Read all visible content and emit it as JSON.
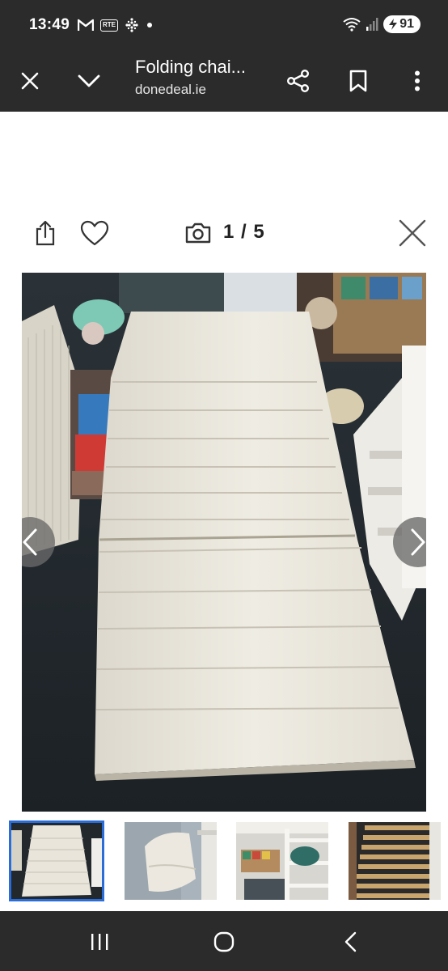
{
  "status_bar": {
    "time": "13:49",
    "notification_icons": [
      "gmail-icon",
      "rte-icon",
      "grid-dots-icon",
      "dot-icon"
    ],
    "rte_label": "RTE",
    "system_icons": [
      "wifi-icon",
      "signal-icon",
      "battery-icon"
    ],
    "battery_level": "91"
  },
  "app_bar": {
    "title": "Folding chai...",
    "domain": "donedeal.ie",
    "icons": [
      "close-icon",
      "chevron-down-icon",
      "share-icon",
      "bookmark-icon",
      "more-vert-icon"
    ]
  },
  "gallery": {
    "counter": "1 / 5",
    "toolbar_icons": [
      "share-upload-icon",
      "heart-icon",
      "camera-icon",
      "close-icon"
    ],
    "nav_icons": [
      "chevron-left-icon",
      "chevron-right-icon"
    ],
    "current_index": 1,
    "total": 5
  },
  "thumbnails": [
    {
      "name": "mattress",
      "active": true
    },
    {
      "name": "folded-chair",
      "active": false
    },
    {
      "name": "cabin-bed",
      "active": false
    },
    {
      "name": "bed-slats",
      "active": false
    }
  ],
  "nav_bar": {
    "icons": [
      "recents-icon",
      "home-icon",
      "back-icon"
    ]
  },
  "colors": {
    "chrome": "#2b2b2b",
    "active_thumb_border": "#2a6dd9",
    "mattress": "#ebe7dd"
  }
}
